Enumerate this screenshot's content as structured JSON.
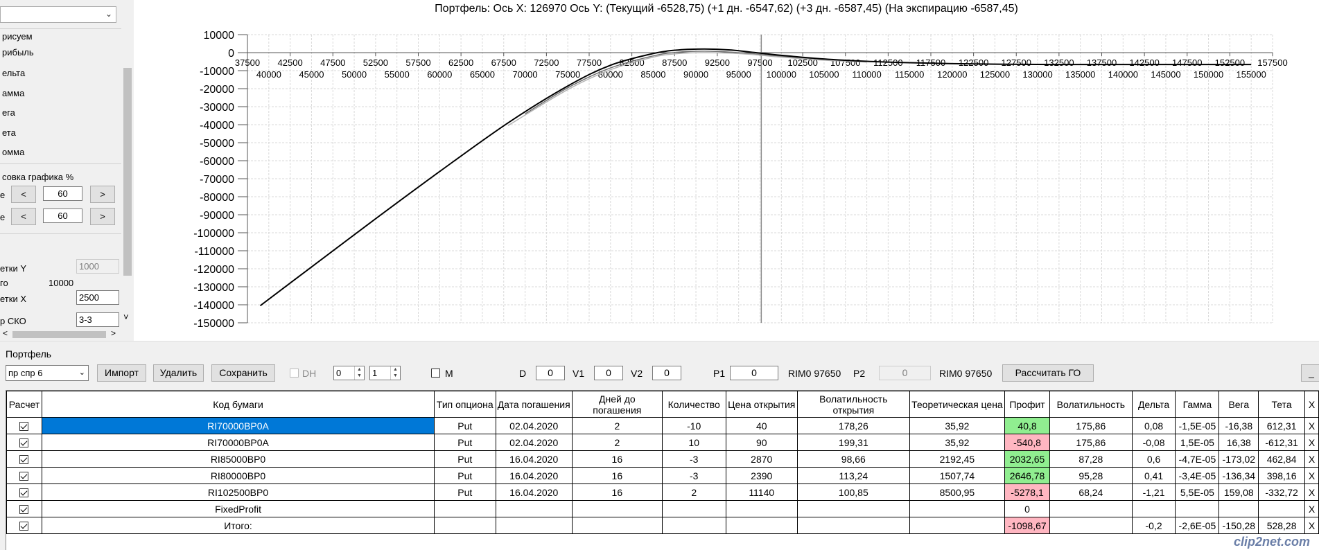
{
  "left_panel": {
    "combo_value": "",
    "labels": [
      "рисуем",
      "рибыль",
      "ельта",
      "амма",
      "ега",
      "ета",
      "омма"
    ],
    "scale_group_title": "совка графика %",
    "row1": {
      "label": "е",
      "prev": "<",
      "value": "60",
      "next": ">"
    },
    "row2": {
      "label": "е",
      "prev": "<",
      "value": "60",
      "next": ">"
    },
    "grid_y_label": "етки Y",
    "grid_y_value": "1000",
    "step_label": "го",
    "step_value": "10000",
    "grid_x_label": "етки X",
    "grid_x_value": "2500",
    "sko_label": "р СКО",
    "sko_value": "3-3",
    "sko_arrow": "˅",
    "hscroll_left": "<",
    "hscroll_right": ">"
  },
  "chart_title": "Портфель: Ось X: 126970 Ось Y:  (Текущий -6528,75)  (+1 дн. -6547,62)  (+3 дн. -6587,45)  (На экспирацию -6587,45)",
  "chart_data": {
    "type": "line",
    "title": "Портфель: Ось X: 126970 Ось Y:  (Текущий -6528,75)  (+1 дн. -6547,62)  (+3 дн. -6587,45)  (На экспирацию -6587,45)",
    "xlim": [
      37500,
      157500
    ],
    "ylim": [
      -150000,
      10000
    ],
    "grid": true,
    "x_ticks_upper": [
      "37500",
      "42500",
      "47500",
      "52500",
      "57500",
      "62500",
      "67500",
      "72500",
      "77500",
      "82500",
      "87500",
      "92500",
      "97500",
      "102500",
      "107500",
      "112500",
      "117500",
      "122500",
      "127500",
      "132500",
      "137500",
      "142500",
      "147500",
      "152500",
      "157500"
    ],
    "x_ticks_lower": [
      "40000",
      "45000",
      "50000",
      "55000",
      "60000",
      "65000",
      "70000",
      "75000",
      "80000",
      "85000",
      "90000",
      "95000",
      "100000",
      "105000",
      "110000",
      "115000",
      "120000",
      "125000",
      "130000",
      "135000",
      "140000",
      "145000",
      "150000",
      "155000"
    ],
    "y_ticks": [
      "10000",
      "0",
      "-10000",
      "-20000",
      "-30000",
      "-40000",
      "-50000",
      "-60000",
      "-70000",
      "-80000",
      "-90000",
      "-100000",
      "-110000",
      "-120000",
      "-130000",
      "-140000",
      "-150000"
    ],
    "cursor_x": 97650,
    "series": [
      {
        "color": "#000000",
        "x": [
          39000,
          45000,
          52000,
          60000,
          68000,
          75000,
          80000,
          85000,
          88000,
          91000,
          94000,
          97000,
          100000,
          105000,
          110000,
          115000,
          120000,
          125000,
          130000,
          140000,
          150000,
          155000
        ],
        "y": [
          -140500,
          -119000,
          -94000,
          -66000,
          -39000,
          -18500,
          -7000,
          -500,
          1500,
          2000,
          1500,
          0,
          -1500,
          -3500,
          -4800,
          -5600,
          -6100,
          -6400,
          -6550,
          -6600,
          -6600,
          -6600
        ]
      },
      {
        "color": "#b4b4b4",
        "x": [
          68000,
          75000,
          80000,
          85000,
          88000,
          91000,
          94000,
          97000,
          100000,
          105000,
          110000
        ],
        "y": [
          -40500,
          -20500,
          -9500,
          -2500,
          -500,
          0,
          -300,
          -1200,
          -2500,
          -4200,
          -5200
        ]
      },
      {
        "color": "#6e6e6e",
        "x": [
          70000,
          75000,
          80000,
          85000,
          88000,
          91000,
          94000,
          97000,
          100000,
          105000
        ],
        "y": [
          -34000,
          -19500,
          -8500,
          -1800,
          300,
          800,
          300,
          -800,
          -2000,
          -3800
        ]
      }
    ]
  },
  "portfolio": {
    "group_label": "Портфель",
    "combo_value": "пр спр 6",
    "import_label": "Импорт",
    "delete_label": "Удалить",
    "save_label": "Сохранить",
    "dh_label": "DH",
    "spin1_value": "0",
    "spin2_value": "1",
    "m_label": "M",
    "d_label": "D",
    "d_value": "0",
    "v1_label": "V1",
    "v1_value": "0",
    "v2_label": "V2",
    "v2_value": "0",
    "p1_label": "P1",
    "p1_value": "0",
    "p1_ticker": "RIM0 97650",
    "p2_label": "P2",
    "p2_value": "0",
    "p2_ticker": "RIM0 97650",
    "calc_go_label": "Рассчитать ГО",
    "min_label": "_"
  },
  "grid": {
    "columns": [
      "Расчет",
      "Код бумаги",
      "Тип опциона",
      "Дата погашения",
      "Дней до погашения",
      "Количество",
      "Цена открытия",
      "Волатильность открытия",
      "Теоретическая цена",
      "Профит",
      "Волатильность",
      "Дельта",
      "Гамма",
      "Вега",
      "Тета",
      "X"
    ],
    "rows": [
      [
        "",
        "RI70000BP0A",
        "Put",
        "02.04.2020",
        "2",
        "-10",
        "40",
        "178,26",
        "35,92",
        "40,8",
        "175,86",
        "0,08",
        "-1,5E-05",
        "-16,38",
        "612,31",
        "X"
      ],
      [
        "",
        "RI70000BP0A",
        "Put",
        "02.04.2020",
        "2",
        "10",
        "90",
        "199,31",
        "35,92",
        "-540,8",
        "175,86",
        "-0,08",
        "1,5E-05",
        "16,38",
        "-612,31",
        "X"
      ],
      [
        "",
        "RI85000BP0",
        "Put",
        "16.04.2020",
        "16",
        "-3",
        "2870",
        "98,66",
        "2192,45",
        "2032,65",
        "87,28",
        "0,6",
        "-4,7E-05",
        "-173,02",
        "462,84",
        "X"
      ],
      [
        "",
        "RI80000BP0",
        "Put",
        "16.04.2020",
        "16",
        "-3",
        "2390",
        "113,24",
        "1507,74",
        "2646,78",
        "95,28",
        "0,41",
        "-3,4E-05",
        "-136,34",
        "398,16",
        "X"
      ],
      [
        "",
        "RI102500BP0",
        "Put",
        "16.04.2020",
        "16",
        "2",
        "11140",
        "100,85",
        "8500,95",
        "-5278,1",
        "68,24",
        "-1,21",
        "5,5E-05",
        "159,08",
        "-332,72",
        "X"
      ],
      [
        "",
        "FixedProfit",
        "",
        "",
        "",
        "",
        "",
        "",
        "",
        "0",
        "",
        "",
        "",
        "",
        "",
        "X"
      ],
      [
        "",
        "Итого:",
        "",
        "",
        "",
        "",
        "",
        "",
        "",
        "-1098,67",
        "",
        "-0,2",
        "-2,6E-05",
        "-150,28",
        "528,28",
        "X"
      ]
    ],
    "profit_colors": {
      "positive": "#90ee90",
      "negative": "#ffb6c1"
    },
    "selection_color": "#0078d7"
  },
  "watermark": "clip2net.com"
}
